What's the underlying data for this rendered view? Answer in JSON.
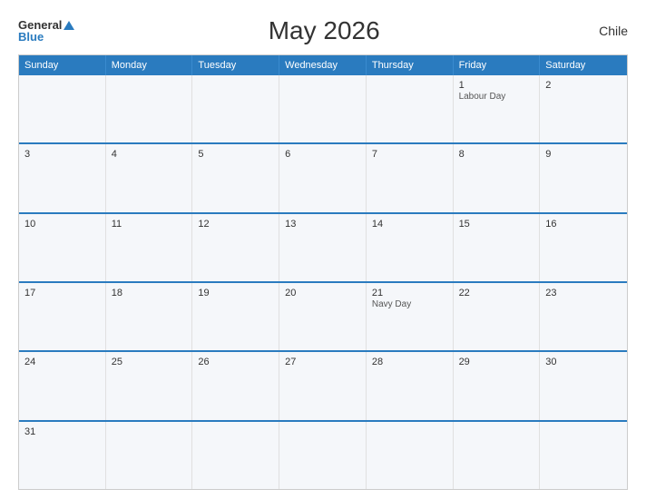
{
  "header": {
    "logo_general": "General",
    "logo_blue": "Blue",
    "title": "May 2026",
    "country": "Chile"
  },
  "dayHeaders": [
    "Sunday",
    "Monday",
    "Tuesday",
    "Wednesday",
    "Thursday",
    "Friday",
    "Saturday"
  ],
  "weeks": [
    [
      {
        "day": "",
        "event": ""
      },
      {
        "day": "",
        "event": ""
      },
      {
        "day": "",
        "event": ""
      },
      {
        "day": "",
        "event": ""
      },
      {
        "day": "",
        "event": ""
      },
      {
        "day": "1",
        "event": "Labour Day"
      },
      {
        "day": "2",
        "event": ""
      }
    ],
    [
      {
        "day": "3",
        "event": ""
      },
      {
        "day": "4",
        "event": ""
      },
      {
        "day": "5",
        "event": ""
      },
      {
        "day": "6",
        "event": ""
      },
      {
        "day": "7",
        "event": ""
      },
      {
        "day": "8",
        "event": ""
      },
      {
        "day": "9",
        "event": ""
      }
    ],
    [
      {
        "day": "10",
        "event": ""
      },
      {
        "day": "11",
        "event": ""
      },
      {
        "day": "12",
        "event": ""
      },
      {
        "day": "13",
        "event": ""
      },
      {
        "day": "14",
        "event": ""
      },
      {
        "day": "15",
        "event": ""
      },
      {
        "day": "16",
        "event": ""
      }
    ],
    [
      {
        "day": "17",
        "event": ""
      },
      {
        "day": "18",
        "event": ""
      },
      {
        "day": "19",
        "event": ""
      },
      {
        "day": "20",
        "event": ""
      },
      {
        "day": "21",
        "event": "Navy Day"
      },
      {
        "day": "22",
        "event": ""
      },
      {
        "day": "23",
        "event": ""
      }
    ],
    [
      {
        "day": "24",
        "event": ""
      },
      {
        "day": "25",
        "event": ""
      },
      {
        "day": "26",
        "event": ""
      },
      {
        "day": "27",
        "event": ""
      },
      {
        "day": "28",
        "event": ""
      },
      {
        "day": "29",
        "event": ""
      },
      {
        "day": "30",
        "event": ""
      }
    ],
    [
      {
        "day": "31",
        "event": ""
      },
      {
        "day": "",
        "event": ""
      },
      {
        "day": "",
        "event": ""
      },
      {
        "day": "",
        "event": ""
      },
      {
        "day": "",
        "event": ""
      },
      {
        "day": "",
        "event": ""
      },
      {
        "day": "",
        "event": ""
      }
    ]
  ]
}
